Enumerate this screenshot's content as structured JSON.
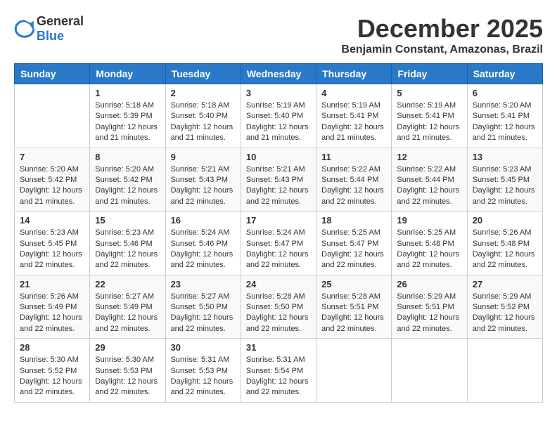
{
  "header": {
    "logo_general": "General",
    "logo_blue": "Blue",
    "month_title": "December 2025",
    "location": "Benjamin Constant, Amazonas, Brazil"
  },
  "calendar": {
    "days_of_week": [
      "Sunday",
      "Monday",
      "Tuesday",
      "Wednesday",
      "Thursday",
      "Friday",
      "Saturday"
    ],
    "weeks": [
      [
        {
          "day": "",
          "info": ""
        },
        {
          "day": "1",
          "info": "Sunrise: 5:18 AM\nSunset: 5:39 PM\nDaylight: 12 hours\nand 21 minutes."
        },
        {
          "day": "2",
          "info": "Sunrise: 5:18 AM\nSunset: 5:40 PM\nDaylight: 12 hours\nand 21 minutes."
        },
        {
          "day": "3",
          "info": "Sunrise: 5:19 AM\nSunset: 5:40 PM\nDaylight: 12 hours\nand 21 minutes."
        },
        {
          "day": "4",
          "info": "Sunrise: 5:19 AM\nSunset: 5:41 PM\nDaylight: 12 hours\nand 21 minutes."
        },
        {
          "day": "5",
          "info": "Sunrise: 5:19 AM\nSunset: 5:41 PM\nDaylight: 12 hours\nand 21 minutes."
        },
        {
          "day": "6",
          "info": "Sunrise: 5:20 AM\nSunset: 5:41 PM\nDaylight: 12 hours\nand 21 minutes."
        }
      ],
      [
        {
          "day": "7",
          "info": "Sunrise: 5:20 AM\nSunset: 5:42 PM\nDaylight: 12 hours\nand 21 minutes."
        },
        {
          "day": "8",
          "info": "Sunrise: 5:20 AM\nSunset: 5:42 PM\nDaylight: 12 hours\nand 21 minutes."
        },
        {
          "day": "9",
          "info": "Sunrise: 5:21 AM\nSunset: 5:43 PM\nDaylight: 12 hours\nand 22 minutes."
        },
        {
          "day": "10",
          "info": "Sunrise: 5:21 AM\nSunset: 5:43 PM\nDaylight: 12 hours\nand 22 minutes."
        },
        {
          "day": "11",
          "info": "Sunrise: 5:22 AM\nSunset: 5:44 PM\nDaylight: 12 hours\nand 22 minutes."
        },
        {
          "day": "12",
          "info": "Sunrise: 5:22 AM\nSunset: 5:44 PM\nDaylight: 12 hours\nand 22 minutes."
        },
        {
          "day": "13",
          "info": "Sunrise: 5:23 AM\nSunset: 5:45 PM\nDaylight: 12 hours\nand 22 minutes."
        }
      ],
      [
        {
          "day": "14",
          "info": "Sunrise: 5:23 AM\nSunset: 5:45 PM\nDaylight: 12 hours\nand 22 minutes."
        },
        {
          "day": "15",
          "info": "Sunrise: 5:23 AM\nSunset: 5:46 PM\nDaylight: 12 hours\nand 22 minutes."
        },
        {
          "day": "16",
          "info": "Sunrise: 5:24 AM\nSunset: 5:46 PM\nDaylight: 12 hours\nand 22 minutes."
        },
        {
          "day": "17",
          "info": "Sunrise: 5:24 AM\nSunset: 5:47 PM\nDaylight: 12 hours\nand 22 minutes."
        },
        {
          "day": "18",
          "info": "Sunrise: 5:25 AM\nSunset: 5:47 PM\nDaylight: 12 hours\nand 22 minutes."
        },
        {
          "day": "19",
          "info": "Sunrise: 5:25 AM\nSunset: 5:48 PM\nDaylight: 12 hours\nand 22 minutes."
        },
        {
          "day": "20",
          "info": "Sunrise: 5:26 AM\nSunset: 5:48 PM\nDaylight: 12 hours\nand 22 minutes."
        }
      ],
      [
        {
          "day": "21",
          "info": "Sunrise: 5:26 AM\nSunset: 5:49 PM\nDaylight: 12 hours\nand 22 minutes."
        },
        {
          "day": "22",
          "info": "Sunrise: 5:27 AM\nSunset: 5:49 PM\nDaylight: 12 hours\nand 22 minutes."
        },
        {
          "day": "23",
          "info": "Sunrise: 5:27 AM\nSunset: 5:50 PM\nDaylight: 12 hours\nand 22 minutes."
        },
        {
          "day": "24",
          "info": "Sunrise: 5:28 AM\nSunset: 5:50 PM\nDaylight: 12 hours\nand 22 minutes."
        },
        {
          "day": "25",
          "info": "Sunrise: 5:28 AM\nSunset: 5:51 PM\nDaylight: 12 hours\nand 22 minutes."
        },
        {
          "day": "26",
          "info": "Sunrise: 5:29 AM\nSunset: 5:51 PM\nDaylight: 12 hours\nand 22 minutes."
        },
        {
          "day": "27",
          "info": "Sunrise: 5:29 AM\nSunset: 5:52 PM\nDaylight: 12 hours\nand 22 minutes."
        }
      ],
      [
        {
          "day": "28",
          "info": "Sunrise: 5:30 AM\nSunset: 5:52 PM\nDaylight: 12 hours\nand 22 minutes."
        },
        {
          "day": "29",
          "info": "Sunrise: 5:30 AM\nSunset: 5:53 PM\nDaylight: 12 hours\nand 22 minutes."
        },
        {
          "day": "30",
          "info": "Sunrise: 5:31 AM\nSunset: 5:53 PM\nDaylight: 12 hours\nand 22 minutes."
        },
        {
          "day": "31",
          "info": "Sunrise: 5:31 AM\nSunset: 5:54 PM\nDaylight: 12 hours\nand 22 minutes."
        },
        {
          "day": "",
          "info": ""
        },
        {
          "day": "",
          "info": ""
        },
        {
          "day": "",
          "info": ""
        }
      ]
    ]
  }
}
